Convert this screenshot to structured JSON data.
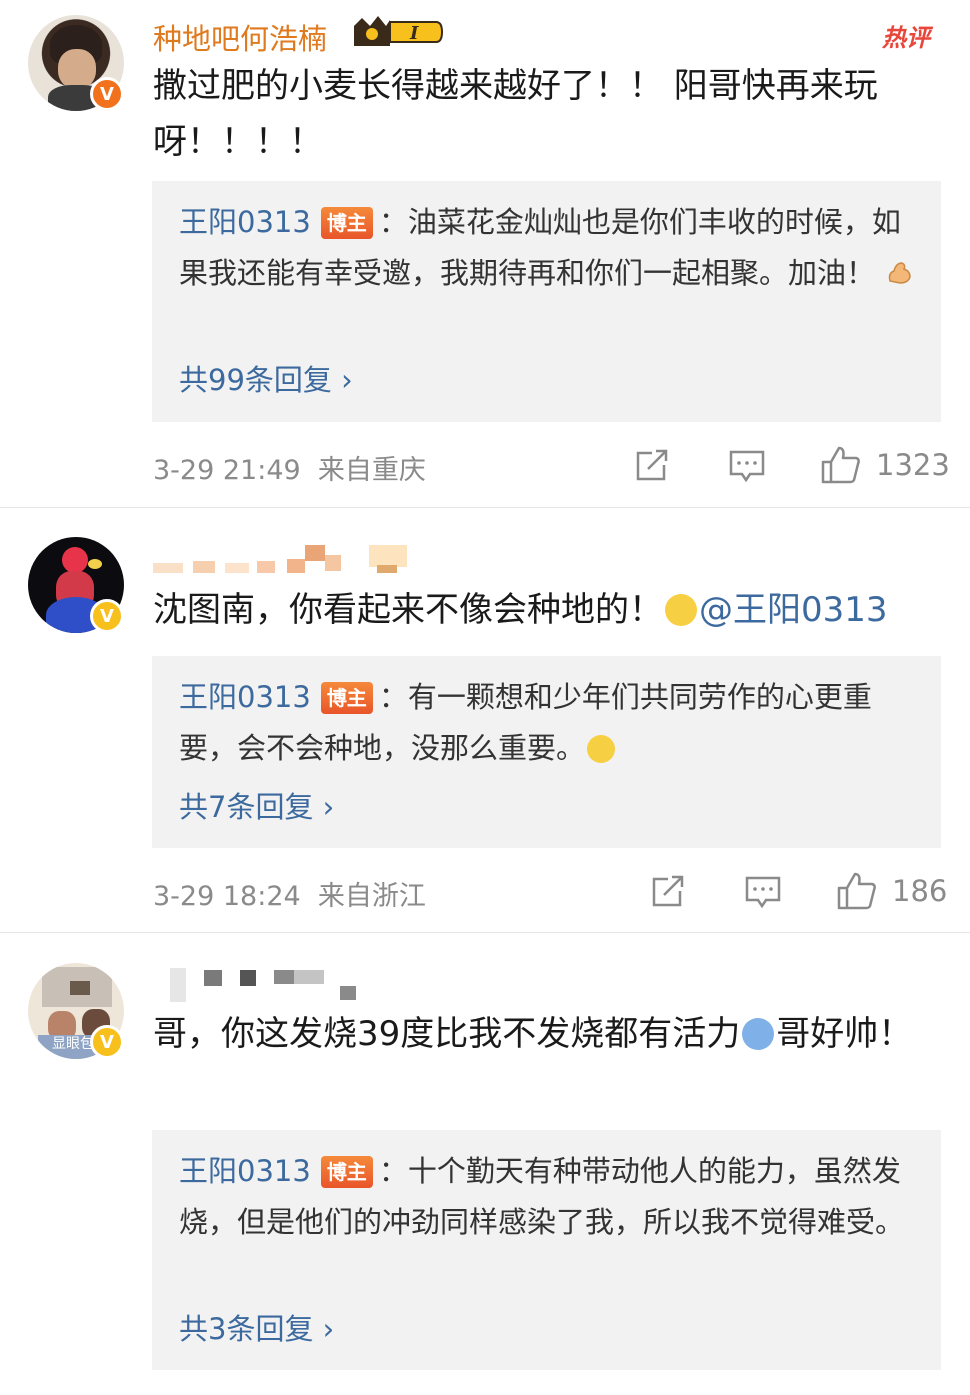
{
  "comments": [
    {
      "username": "种地吧何浩楠",
      "level_badge": "I",
      "hot_label": "热评",
      "text": "撒过肥的小麦长得越来越好了！！ 阳哥快再来玩呀！！！！",
      "reply": {
        "user": "王阳0313",
        "badge": "博主",
        "text": "：油菜花金灿灿也是你们丰收的时候，如果我还能有幸受邀，我期待再和你们一起相聚。加油！",
        "more": "共99条回复 ›"
      },
      "time": "3-29 21:49",
      "location": "来自重庆",
      "likes": "1323"
    },
    {
      "username": "",
      "text": "沈图南，你看起来不像会种地的！",
      "mention": "@王阳0313",
      "reply": {
        "user": "王阳0313",
        "badge": "博主",
        "text": "：有一颗想和少年们共同劳作的心更重要，会不会种地，没那么重要。",
        "more": "共7条回复 ›"
      },
      "time": "3-29 18:24",
      "location": "来自浙江",
      "likes": "186"
    },
    {
      "username": "",
      "avatar_text": "显眼包",
      "text": "哥，你这发烧39度比我不发烧都有活力",
      "text_tail": "哥好帅！",
      "reply": {
        "user": "王阳0313",
        "badge": "博主",
        "text": "：十个勤天有种带动他人的能力，虽然发烧，但是他们的冲劲同样感染了我，所以我不觉得难受。",
        "more": "共3条回复 ›"
      }
    }
  ],
  "colors": {
    "link": "#3d6a9e",
    "username": "#e07a1f",
    "meta": "#8a8a8a",
    "reply_bg": "#f2f2f2"
  },
  "icons": [
    "share-icon",
    "comment-icon",
    "like-icon"
  ]
}
